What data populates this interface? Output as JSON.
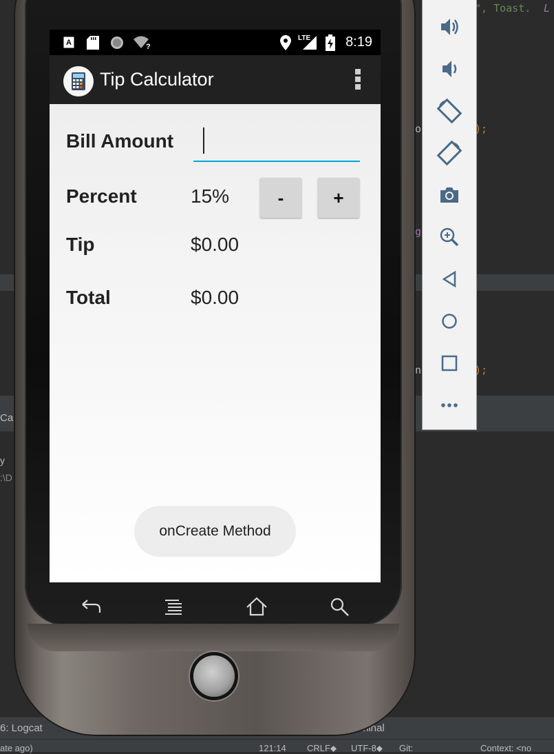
{
  "ide": {
    "code_snippet_top": "\", Toast.",
    "code_snippet_top_tail": "L",
    "code_line_paren1": "o",
    "code_line_paren1_tail": ");",
    "code_line_g": "g",
    "code_line_n": "n",
    "code_line_paren2_tail": ");",
    "panel_tab_left": "Ca",
    "panel_text_y": "y",
    "panel_text_path": ":\\D",
    "bottom_tab_logcat": "6: Logcat",
    "bottom_tab_terminal": "Terminal",
    "status_left": "ate ago)",
    "status_position": "121:14",
    "status_line_sep": "CRLF⬥",
    "status_encoding": "UTF-8⬥",
    "status_git": "Git:",
    "status_context": "Context: <no"
  },
  "phone": {
    "status_bar": {
      "time": "8:19",
      "network": "LTE",
      "wifi_hint": "?",
      "notif_a": "A"
    },
    "app": {
      "title": "Tip Calculator",
      "icon": "calculator-icon"
    },
    "form": {
      "bill_label": "Bill Amount",
      "bill_value": "",
      "percent_label": "Percent",
      "percent_value": "15%",
      "minus_label": "-",
      "plus_label": "+",
      "tip_label": "Tip",
      "tip_value": "$0.00",
      "total_label": "Total",
      "total_value": "$0.00"
    },
    "toast": "onCreate Method",
    "nav": [
      "back-icon",
      "menu-icon",
      "home-icon",
      "search-icon"
    ]
  },
  "emulator_toolbar": {
    "tools": [
      "volume-up-icon",
      "volume-down-icon",
      "rotate-left-icon",
      "rotate-right-icon",
      "camera-icon",
      "zoom-icon",
      "back-icon",
      "home-icon",
      "overview-icon",
      "more-icon"
    ]
  },
  "colors": {
    "accent": "#00a6d6",
    "action_bar": "#212121",
    "ide_bg": "#2b2b2b",
    "toolbar_icon": "#4a6a87"
  }
}
